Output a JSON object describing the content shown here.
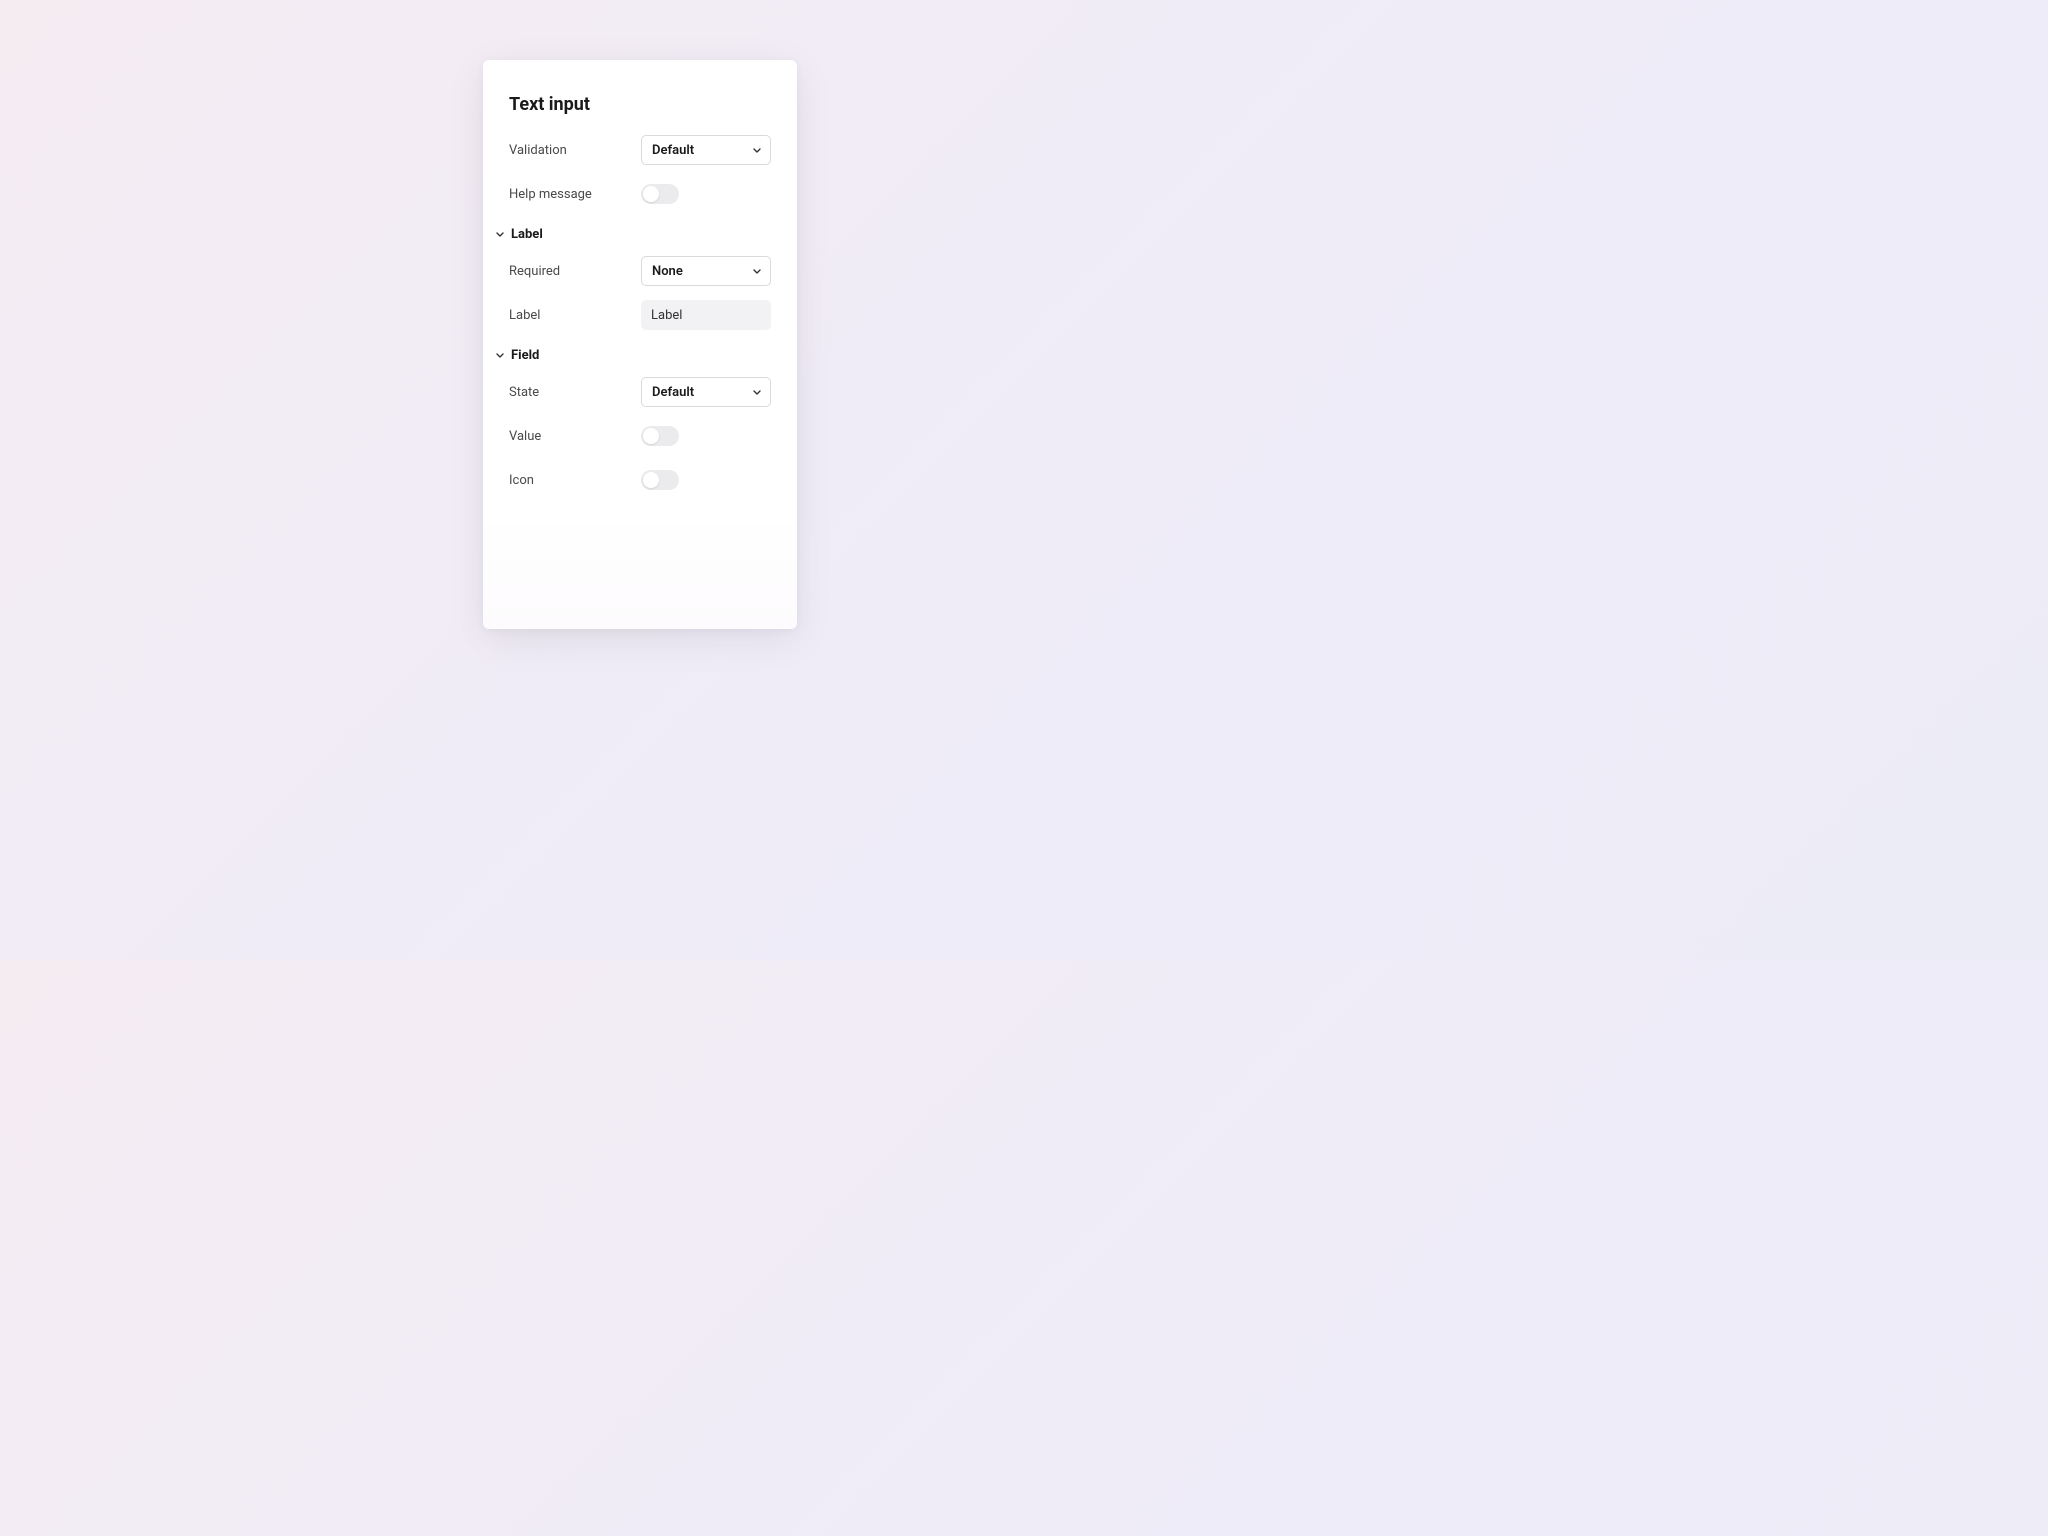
{
  "panel": {
    "title": "Text input",
    "validation": {
      "label": "Validation",
      "value": "Default"
    },
    "help_message": {
      "label": "Help message",
      "on": false
    },
    "sections": {
      "label": {
        "title": "Label",
        "required": {
          "label": "Required",
          "value": "None"
        },
        "labelfield": {
          "label": "Label",
          "value": "Label"
        }
      },
      "field": {
        "title": "Field",
        "state": {
          "label": "State",
          "value": "Default"
        },
        "value_toggle": {
          "label": "Value",
          "on": false
        },
        "icon_toggle": {
          "label": "Icon",
          "on": false
        }
      }
    }
  }
}
